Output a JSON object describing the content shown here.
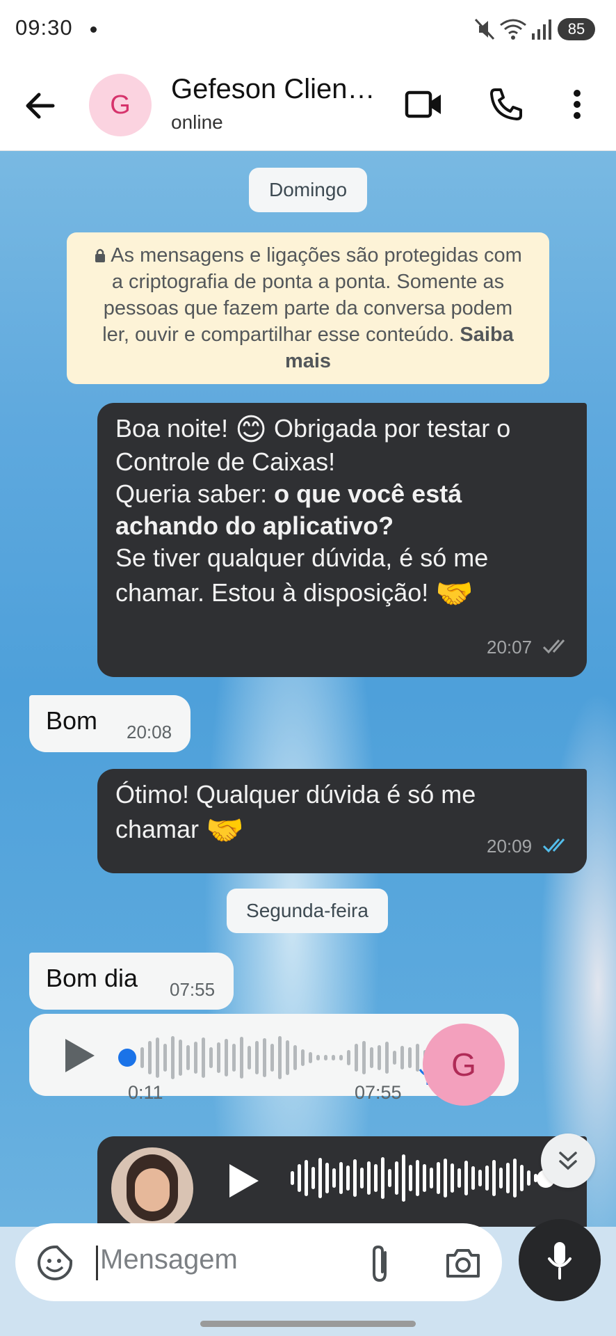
{
  "status_bar": {
    "time": "09:30",
    "battery": "85"
  },
  "header": {
    "avatar_letter": "G",
    "contact_name": "Gefeson Client…",
    "contact_status": "online"
  },
  "chat": {
    "date_sunday": "Domingo",
    "encryption_text": "As mensagens e ligações são protegidas com a criptografia de ponta a ponta. Somente as pessoas que fazem parte da conversa podem ler, ouvir e compartilhar esse conteúdo.",
    "encryption_link": "Saiba mais",
    "messages": [
      {
        "line1a": "Boa noite!",
        "emoji1": "😊",
        "line1b": "Obrigada por testar o",
        "line2": "Controle de Caixas!",
        "line3a": "Queria saber: ",
        "line3b": "o que você está",
        "line4": "achando do aplicativo?",
        "line5": "Se tiver qualquer dúvida, é só me",
        "line6": "chamar. Estou à disposição!",
        "emoji2": "🤝",
        "time": "20:07"
      },
      {
        "text": "Bom",
        "time": "20:08"
      },
      {
        "line1": "Ótimo! Qualquer dúvida é só me",
        "line2": "chamar",
        "emoji": "🤝",
        "time": "20:09"
      },
      {
        "text": "Bom dia",
        "time": "07:55"
      },
      {
        "elapsed": "0:11",
        "time": "07:55",
        "avatar_letter": "G"
      }
    ],
    "date_monday": "Segunda-feira"
  },
  "input": {
    "placeholder": "Mensagem"
  },
  "colors": {
    "read_tick": "#53bdeb",
    "sent_tick": "#9a9c9e",
    "accent_blue": "#1a73e8"
  }
}
